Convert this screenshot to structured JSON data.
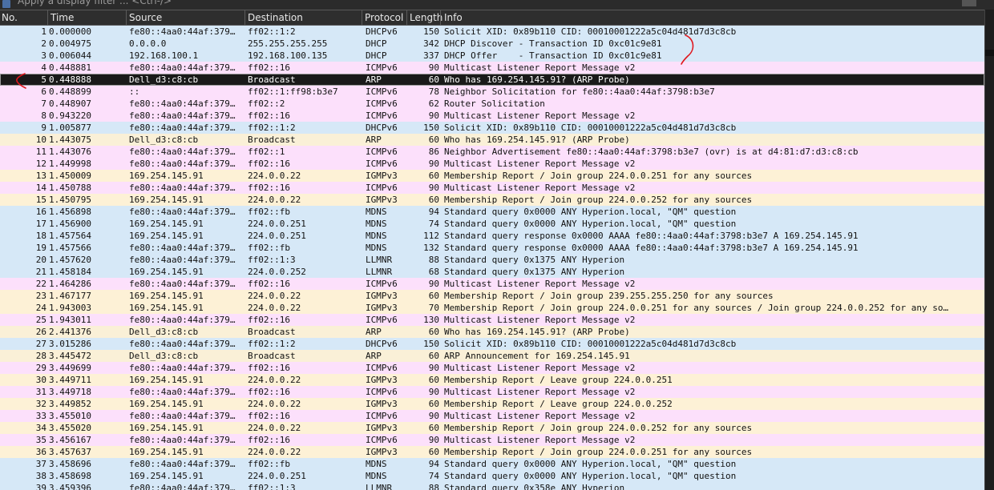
{
  "filter": {
    "placeholder": "Apply a display filter ... <Ctrl-/>"
  },
  "columns": [
    {
      "key": "no",
      "label": "No."
    },
    {
      "key": "time",
      "label": "Time"
    },
    {
      "key": "src",
      "label": "Source"
    },
    {
      "key": "dst",
      "label": "Destination"
    },
    {
      "key": "proto",
      "label": "Protocol"
    },
    {
      "key": "len",
      "label": "Length"
    },
    {
      "key": "info",
      "label": "Info"
    }
  ],
  "protocol_colors": {
    "DHCPv6": "#d6e8f7",
    "DHCP": "#d6e8f7",
    "ICMPv6": "#fce0fb",
    "ARP": "#faf0d7",
    "IGMPv3": "#fdf1d6",
    "MDNS": "#d6e8f7",
    "LLMNR": "#d6e8f7"
  },
  "selected_index": 4,
  "packets": [
    {
      "no": "1",
      "time": "0.000000",
      "src": "fe80::4aa0:44af:379…",
      "dst": "ff02::1:2",
      "proto": "DHCPv6",
      "len": "150",
      "info": "Solicit XID: 0x89b110 CID: 00010001222a5c04d481d7d3c8cb"
    },
    {
      "no": "2",
      "time": "0.004975",
      "src": "0.0.0.0",
      "dst": "255.255.255.255",
      "proto": "DHCP",
      "len": "342",
      "info": "DHCP Discover - Transaction ID 0xc01c9e81"
    },
    {
      "no": "3",
      "time": "0.006044",
      "src": "192.168.100.1",
      "dst": "192.168.100.135",
      "proto": "DHCP",
      "len": "337",
      "info": "DHCP Offer    - Transaction ID 0xc01c9e81"
    },
    {
      "no": "4",
      "time": "0.448881",
      "src": "fe80::4aa0:44af:379…",
      "dst": "ff02::16",
      "proto": "ICMPv6",
      "len": "90",
      "info": "Multicast Listener Report Message v2"
    },
    {
      "no": "5",
      "time": "0.448888",
      "src": "Dell_d3:c8:cb",
      "dst": "Broadcast",
      "proto": "ARP",
      "len": "60",
      "info": "Who has 169.254.145.91? (ARP Probe)"
    },
    {
      "no": "6",
      "time": "0.448899",
      "src": "::",
      "dst": "ff02::1:ff98:b3e7",
      "proto": "ICMPv6",
      "len": "78",
      "info": "Neighbor Solicitation for fe80::4aa0:44af:3798:b3e7"
    },
    {
      "no": "7",
      "time": "0.448907",
      "src": "fe80::4aa0:44af:379…",
      "dst": "ff02::2",
      "proto": "ICMPv6",
      "len": "62",
      "info": "Router Solicitation"
    },
    {
      "no": "8",
      "time": "0.943220",
      "src": "fe80::4aa0:44af:379…",
      "dst": "ff02::16",
      "proto": "ICMPv6",
      "len": "90",
      "info": "Multicast Listener Report Message v2"
    },
    {
      "no": "9",
      "time": "1.005877",
      "src": "fe80::4aa0:44af:379…",
      "dst": "ff02::1:2",
      "proto": "DHCPv6",
      "len": "150",
      "info": "Solicit XID: 0x89b110 CID: 00010001222a5c04d481d7d3c8cb"
    },
    {
      "no": "10",
      "time": "1.443075",
      "src": "Dell_d3:c8:cb",
      "dst": "Broadcast",
      "proto": "ARP",
      "len": "60",
      "info": "Who has 169.254.145.91? (ARP Probe)"
    },
    {
      "no": "11",
      "time": "1.443076",
      "src": "fe80::4aa0:44af:379…",
      "dst": "ff02::1",
      "proto": "ICMPv6",
      "len": "86",
      "info": "Neighbor Advertisement fe80::4aa0:44af:3798:b3e7 (ovr) is at d4:81:d7:d3:c8:cb"
    },
    {
      "no": "12",
      "time": "1.449998",
      "src": "fe80::4aa0:44af:379…",
      "dst": "ff02::16",
      "proto": "ICMPv6",
      "len": "90",
      "info": "Multicast Listener Report Message v2"
    },
    {
      "no": "13",
      "time": "1.450009",
      "src": "169.254.145.91",
      "dst": "224.0.0.22",
      "proto": "IGMPv3",
      "len": "60",
      "info": "Membership Report / Join group 224.0.0.251 for any sources"
    },
    {
      "no": "14",
      "time": "1.450788",
      "src": "fe80::4aa0:44af:379…",
      "dst": "ff02::16",
      "proto": "ICMPv6",
      "len": "90",
      "info": "Multicast Listener Report Message v2"
    },
    {
      "no": "15",
      "time": "1.450795",
      "src": "169.254.145.91",
      "dst": "224.0.0.22",
      "proto": "IGMPv3",
      "len": "60",
      "info": "Membership Report / Join group 224.0.0.252 for any sources"
    },
    {
      "no": "16",
      "time": "1.456898",
      "src": "fe80::4aa0:44af:379…",
      "dst": "ff02::fb",
      "proto": "MDNS",
      "len": "94",
      "info": "Standard query 0x0000 ANY Hyperion.local, \"QM\" question"
    },
    {
      "no": "17",
      "time": "1.456900",
      "src": "169.254.145.91",
      "dst": "224.0.0.251",
      "proto": "MDNS",
      "len": "74",
      "info": "Standard query 0x0000 ANY Hyperion.local, \"QM\" question"
    },
    {
      "no": "18",
      "time": "1.457564",
      "src": "169.254.145.91",
      "dst": "224.0.0.251",
      "proto": "MDNS",
      "len": "112",
      "info": "Standard query response 0x0000 AAAA fe80::4aa0:44af:3798:b3e7 A 169.254.145.91"
    },
    {
      "no": "19",
      "time": "1.457566",
      "src": "fe80::4aa0:44af:379…",
      "dst": "ff02::fb",
      "proto": "MDNS",
      "len": "132",
      "info": "Standard query response 0x0000 AAAA fe80::4aa0:44af:3798:b3e7 A 169.254.145.91"
    },
    {
      "no": "20",
      "time": "1.457620",
      "src": "fe80::4aa0:44af:379…",
      "dst": "ff02::1:3",
      "proto": "LLMNR",
      "len": "88",
      "info": "Standard query 0x1375 ANY Hyperion"
    },
    {
      "no": "21",
      "time": "1.458184",
      "src": "169.254.145.91",
      "dst": "224.0.0.252",
      "proto": "LLMNR",
      "len": "68",
      "info": "Standard query 0x1375 ANY Hyperion"
    },
    {
      "no": "22",
      "time": "1.464286",
      "src": "fe80::4aa0:44af:379…",
      "dst": "ff02::16",
      "proto": "ICMPv6",
      "len": "90",
      "info": "Multicast Listener Report Message v2"
    },
    {
      "no": "23",
      "time": "1.467177",
      "src": "169.254.145.91",
      "dst": "224.0.0.22",
      "proto": "IGMPv3",
      "len": "60",
      "info": "Membership Report / Join group 239.255.255.250 for any sources"
    },
    {
      "no": "24",
      "time": "1.943003",
      "src": "169.254.145.91",
      "dst": "224.0.0.22",
      "proto": "IGMPv3",
      "len": "70",
      "info": "Membership Report / Join group 224.0.0.251 for any sources / Join group 224.0.0.252 for any so…"
    },
    {
      "no": "25",
      "time": "1.943011",
      "src": "fe80::4aa0:44af:379…",
      "dst": "ff02::16",
      "proto": "ICMPv6",
      "len": "130",
      "info": "Multicast Listener Report Message v2"
    },
    {
      "no": "26",
      "time": "2.441376",
      "src": "Dell_d3:c8:cb",
      "dst": "Broadcast",
      "proto": "ARP",
      "len": "60",
      "info": "Who has 169.254.145.91? (ARP Probe)"
    },
    {
      "no": "27",
      "time": "3.015286",
      "src": "fe80::4aa0:44af:379…",
      "dst": "ff02::1:2",
      "proto": "DHCPv6",
      "len": "150",
      "info": "Solicit XID: 0x89b110 CID: 00010001222a5c04d481d7d3c8cb"
    },
    {
      "no": "28",
      "time": "3.445472",
      "src": "Dell_d3:c8:cb",
      "dst": "Broadcast",
      "proto": "ARP",
      "len": "60",
      "info": "ARP Announcement for 169.254.145.91"
    },
    {
      "no": "29",
      "time": "3.449699",
      "src": "fe80::4aa0:44af:379…",
      "dst": "ff02::16",
      "proto": "ICMPv6",
      "len": "90",
      "info": "Multicast Listener Report Message v2"
    },
    {
      "no": "30",
      "time": "3.449711",
      "src": "169.254.145.91",
      "dst": "224.0.0.22",
      "proto": "IGMPv3",
      "len": "60",
      "info": "Membership Report / Leave group 224.0.0.251"
    },
    {
      "no": "31",
      "time": "3.449718",
      "src": "fe80::4aa0:44af:379…",
      "dst": "ff02::16",
      "proto": "ICMPv6",
      "len": "90",
      "info": "Multicast Listener Report Message v2"
    },
    {
      "no": "32",
      "time": "3.449852",
      "src": "169.254.145.91",
      "dst": "224.0.0.22",
      "proto": "IGMPv3",
      "len": "60",
      "info": "Membership Report / Leave group 224.0.0.252"
    },
    {
      "no": "33",
      "time": "3.455010",
      "src": "fe80::4aa0:44af:379…",
      "dst": "ff02::16",
      "proto": "ICMPv6",
      "len": "90",
      "info": "Multicast Listener Report Message v2"
    },
    {
      "no": "34",
      "time": "3.455020",
      "src": "169.254.145.91",
      "dst": "224.0.0.22",
      "proto": "IGMPv3",
      "len": "60",
      "info": "Membership Report / Join group 224.0.0.252 for any sources"
    },
    {
      "no": "35",
      "time": "3.456167",
      "src": "fe80::4aa0:44af:379…",
      "dst": "ff02::16",
      "proto": "ICMPv6",
      "len": "90",
      "info": "Multicast Listener Report Message v2"
    },
    {
      "no": "36",
      "time": "3.457637",
      "src": "169.254.145.91",
      "dst": "224.0.0.22",
      "proto": "IGMPv3",
      "len": "60",
      "info": "Membership Report / Join group 224.0.0.251 for any sources"
    },
    {
      "no": "37",
      "time": "3.458696",
      "src": "fe80::4aa0:44af:379…",
      "dst": "ff02::fb",
      "proto": "MDNS",
      "len": "94",
      "info": "Standard query 0x0000 ANY Hyperion.local, \"QM\" question"
    },
    {
      "no": "38",
      "time": "3.458698",
      "src": "169.254.145.91",
      "dst": "224.0.0.251",
      "proto": "MDNS",
      "len": "74",
      "info": "Standard query 0x0000 ANY Hyperion.local, \"QM\" question"
    },
    {
      "no": "39",
      "time": "3.459396",
      "src": "fe80::4aa0:44af:379…",
      "dst": "ff02::1:3",
      "proto": "LLMNR",
      "len": "88",
      "info": "Standard query 0x358e ANY Hyperion"
    }
  ]
}
